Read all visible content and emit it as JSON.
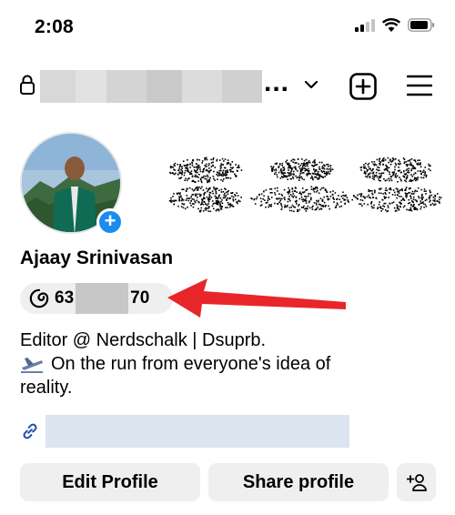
{
  "status_bar": {
    "time": "2:08",
    "icons": [
      "signal-icon",
      "wifi-icon",
      "battery-icon"
    ]
  },
  "header": {
    "username_ellipsis": "...",
    "icons": [
      "lock-icon",
      "chevron-down-icon",
      "new-post-icon",
      "menu-icon"
    ]
  },
  "profile": {
    "display_name": "Ajaay Srinivasan",
    "threads": {
      "count_prefix": "63",
      "count_suffix": "70"
    },
    "bio_line1": "Editor @ Nerdschalk | Dsuprb.",
    "bio_line2": "On the run from everyone's idea of",
    "bio_line3": "reality."
  },
  "actions": {
    "edit_label": "Edit Profile",
    "share_label": "Share profile"
  },
  "colors": {
    "accent_blue": "#1a8cf0",
    "button_bg": "#efefef",
    "arrow_red": "#e8262a"
  }
}
